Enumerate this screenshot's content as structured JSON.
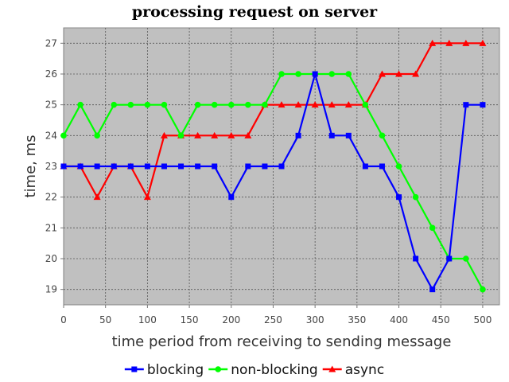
{
  "chart_data": {
    "type": "line",
    "title": "processing request on server",
    "xlabel": "time period from receiving to sending message",
    "ylabel": "time, ms",
    "xlim": [
      0,
      520
    ],
    "ylim": [
      18.5,
      27.5
    ],
    "xticks": [
      0,
      50,
      100,
      150,
      200,
      250,
      300,
      350,
      400,
      450,
      500
    ],
    "yticks": [
      19,
      20,
      21,
      22,
      23,
      24,
      25,
      26,
      27
    ],
    "grid": true,
    "legend_position": "bottom",
    "plot_background": "#c0c0c0",
    "x": [
      0,
      20,
      40,
      60,
      80,
      100,
      120,
      140,
      160,
      180,
      200,
      220,
      240,
      260,
      280,
      300,
      320,
      340,
      360,
      380,
      400,
      420,
      440,
      460,
      480,
      500
    ],
    "series": [
      {
        "name": "blocking",
        "color": "#0000ff",
        "marker": "square",
        "values": [
          23,
          23,
          23,
          23,
          23,
          23,
          23,
          23,
          23,
          23,
          22,
          23,
          23,
          23,
          24,
          26,
          24,
          24,
          23,
          23,
          22,
          20,
          19,
          20,
          25,
          25
        ]
      },
      {
        "name": "non-blocking",
        "color": "#00ff00",
        "marker": "circle",
        "values": [
          24,
          25,
          24,
          25,
          25,
          25,
          25,
          24,
          25,
          25,
          25,
          25,
          25,
          26,
          26,
          26,
          26,
          26,
          25,
          24,
          23,
          22,
          21,
          20,
          20,
          19
        ]
      },
      {
        "name": "async",
        "color": "#ff0000",
        "marker": "triangle",
        "values": [
          23,
          23,
          22,
          23,
          23,
          22,
          24,
          24,
          24,
          24,
          24,
          24,
          25,
          25,
          25,
          25,
          25,
          25,
          25,
          26,
          26,
          26,
          27,
          27,
          27,
          27
        ]
      }
    ]
  }
}
